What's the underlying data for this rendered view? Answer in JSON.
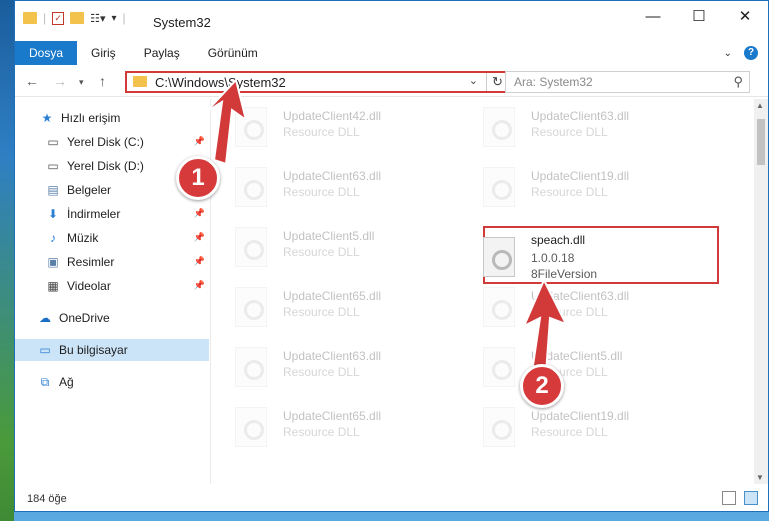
{
  "window": {
    "title": "System32"
  },
  "ribbon": {
    "tabs": [
      {
        "label": "Dosya",
        "active": true
      },
      {
        "label": "Giriş",
        "active": false
      },
      {
        "label": "Paylaş",
        "active": false
      },
      {
        "label": "Görünüm",
        "active": false
      }
    ]
  },
  "nav": {
    "path": "C:\\Windows\\System32",
    "search_placeholder": "Ara: System32"
  },
  "sidebar": {
    "items": [
      {
        "label": "Hızlı erişim",
        "icon": "star-icon"
      },
      {
        "label": "Yerel Disk (C:)",
        "icon": "drive-icon",
        "pinned": true
      },
      {
        "label": "Yerel Disk (D:)",
        "icon": "drive-icon"
      },
      {
        "label": "Belgeler",
        "icon": "documents-icon"
      },
      {
        "label": "İndirmeler",
        "icon": "download-icon",
        "pinned": true
      },
      {
        "label": "Müzik",
        "icon": "music-icon",
        "pinned": true
      },
      {
        "label": "Resimler",
        "icon": "pictures-icon",
        "pinned": true
      },
      {
        "label": "Videolar",
        "icon": "videos-icon",
        "pinned": true
      },
      {
        "label": "OneDrive",
        "icon": "cloud-icon"
      },
      {
        "label": "Bu bilgisayar",
        "icon": "computer-icon",
        "selected": true
      },
      {
        "label": "Ağ",
        "icon": "network-icon"
      }
    ]
  },
  "files": {
    "left": [
      {
        "name": "UpdateClient42.dll",
        "desc": "Resource DLL"
      },
      {
        "name": "UpdateClient63.dll",
        "desc": "Resource DLL"
      },
      {
        "name": "UpdateClient5.dll",
        "desc": "Resource DLL"
      },
      {
        "name": "UpdateClient65.dll",
        "desc": "Resource DLL"
      },
      {
        "name": "UpdateClient63.dll",
        "desc": "Resource DLL"
      },
      {
        "name": "UpdateClient65.dll",
        "desc": "Resource DLL"
      }
    ],
    "right": [
      {
        "name": "UpdateClient63.dll",
        "desc": "Resource DLL"
      },
      {
        "name": "UpdateClient19.dll",
        "desc": "Resource DLL"
      },
      {
        "name": "UpdateClient63.dll",
        "desc": "Resource DLL"
      },
      {
        "name": "UpdateClient5.dll",
        "desc": "Resource DLL"
      },
      {
        "name": "UpdateClient19.dll",
        "desc": "Resource DLL"
      }
    ],
    "highlighted": {
      "name": "speach.dll",
      "version": "1.0.0.18",
      "desc": "8FileVersion"
    }
  },
  "status": {
    "count": "184 öğe"
  },
  "annotations": {
    "step1": "1",
    "step2": "2",
    "color": "#d23a3a"
  }
}
